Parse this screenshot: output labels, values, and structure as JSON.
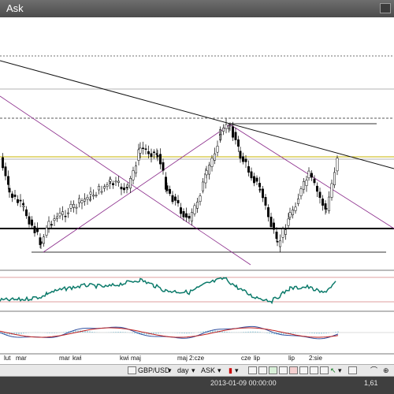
{
  "window": {
    "title": "Ask"
  },
  "chart_data": {
    "type": "candlestick",
    "instrument": "GBP/USD",
    "timeframe": "day",
    "price_side": "ASK",
    "x_tick_labels": [
      "lut",
      "mar",
      "mar",
      "kwi",
      "kwi",
      "maj",
      "maj",
      "2:cze",
      "cze",
      "lip",
      "lip",
      "2:sie"
    ]
  },
  "toolbar": {
    "instrument_label": "GBP/USD",
    "period_label": "day",
    "side_label": "ASK"
  },
  "status": {
    "date": "2013-01-09 00:00:00",
    "price": "1,61"
  }
}
